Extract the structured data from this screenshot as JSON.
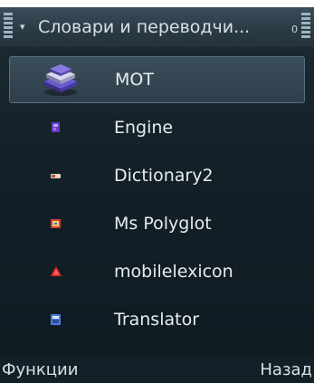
{
  "window": {
    "title": "Словари и переводчи...",
    "item_count": "0"
  },
  "apps": [
    {
      "label": "MOT",
      "icon": "books-stack-icon",
      "selected": true
    },
    {
      "label": "Engine",
      "icon": "engine-app-icon",
      "selected": false
    },
    {
      "label": "Dictionary2",
      "icon": "dictionary2-app-icon",
      "selected": false
    },
    {
      "label": "Ms Polyglot",
      "icon": "ms-polyglot-app-icon",
      "selected": false
    },
    {
      "label": "mobilelexicon",
      "icon": "mobilelexicon-app-icon",
      "selected": false
    },
    {
      "label": "Translator",
      "icon": "translator-app-icon",
      "selected": false
    }
  ],
  "softkeys": {
    "left": "Функции",
    "right": "Назад"
  },
  "colors": {
    "background": "#142028",
    "selection": "#3b4e5b",
    "text": "#e6ecef"
  }
}
